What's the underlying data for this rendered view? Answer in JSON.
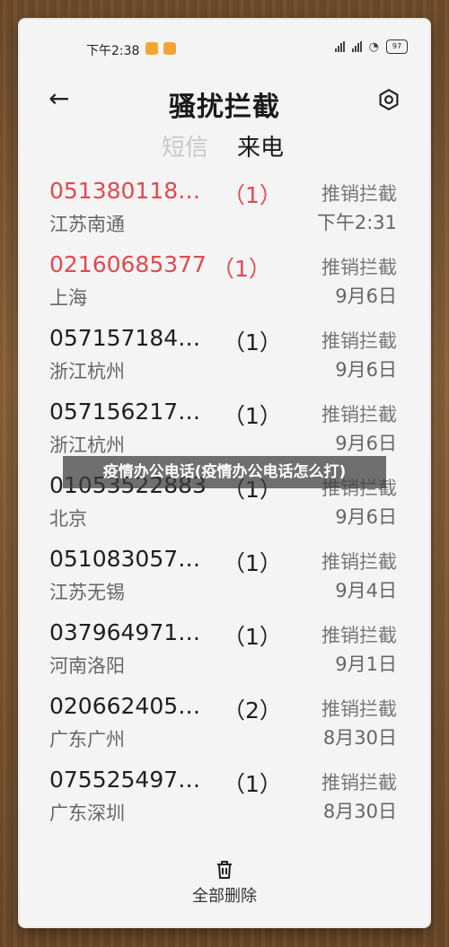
{
  "status_bar": {
    "time": "下午2:38",
    "battery": "97"
  },
  "header": {
    "title": "骚扰拦截",
    "back_icon": "arrow-left-icon",
    "settings_icon": "gear-icon"
  },
  "tabs": [
    {
      "label": "短信"
    },
    {
      "label": "来电"
    }
  ],
  "calls": [
    {
      "number": "051380118…",
      "count": "（1）",
      "location": "江苏南通",
      "tag": "推销拦截",
      "time": "下午2:31"
    },
    {
      "number": "02160685377",
      "count": "（1）",
      "location": "上海",
      "tag": "推销拦截",
      "time": "9月6日"
    },
    {
      "number": "057157184…",
      "count": "（1）",
      "location": "浙江杭州",
      "tag": "推销拦截",
      "time": "9月6日"
    },
    {
      "number": "057156217…",
      "count": "（1）",
      "location": "浙江杭州",
      "tag": "推销拦截",
      "time": "9月6日"
    },
    {
      "number": "01053522883",
      "count": "（1）",
      "location": "北京",
      "tag": "推销拦截",
      "time": "9月6日"
    },
    {
      "number": "051083057…",
      "count": "（1）",
      "location": "江苏无锡",
      "tag": "推销拦截",
      "time": "9月4日"
    },
    {
      "number": "037964971…",
      "count": "（1）",
      "location": "河南洛阳",
      "tag": "推销拦截",
      "time": "9月1日"
    },
    {
      "number": "020662405…",
      "count": "（2）",
      "location": "广东广州",
      "tag": "推销拦截",
      "time": "8月30日"
    },
    {
      "number": "075525497…",
      "count": "（1）",
      "location": "广东深圳",
      "tag": "推销拦截",
      "time": "8月30日"
    }
  ],
  "bottom": {
    "delete_all_label": "全部删除"
  },
  "overlay_caption": "疫情办公电话(疫情办公电话怎么打)",
  "colors": {
    "missed_red": "#e5484d",
    "background_wood": "#7a5632",
    "screen_bg": "#f4f4f4"
  }
}
